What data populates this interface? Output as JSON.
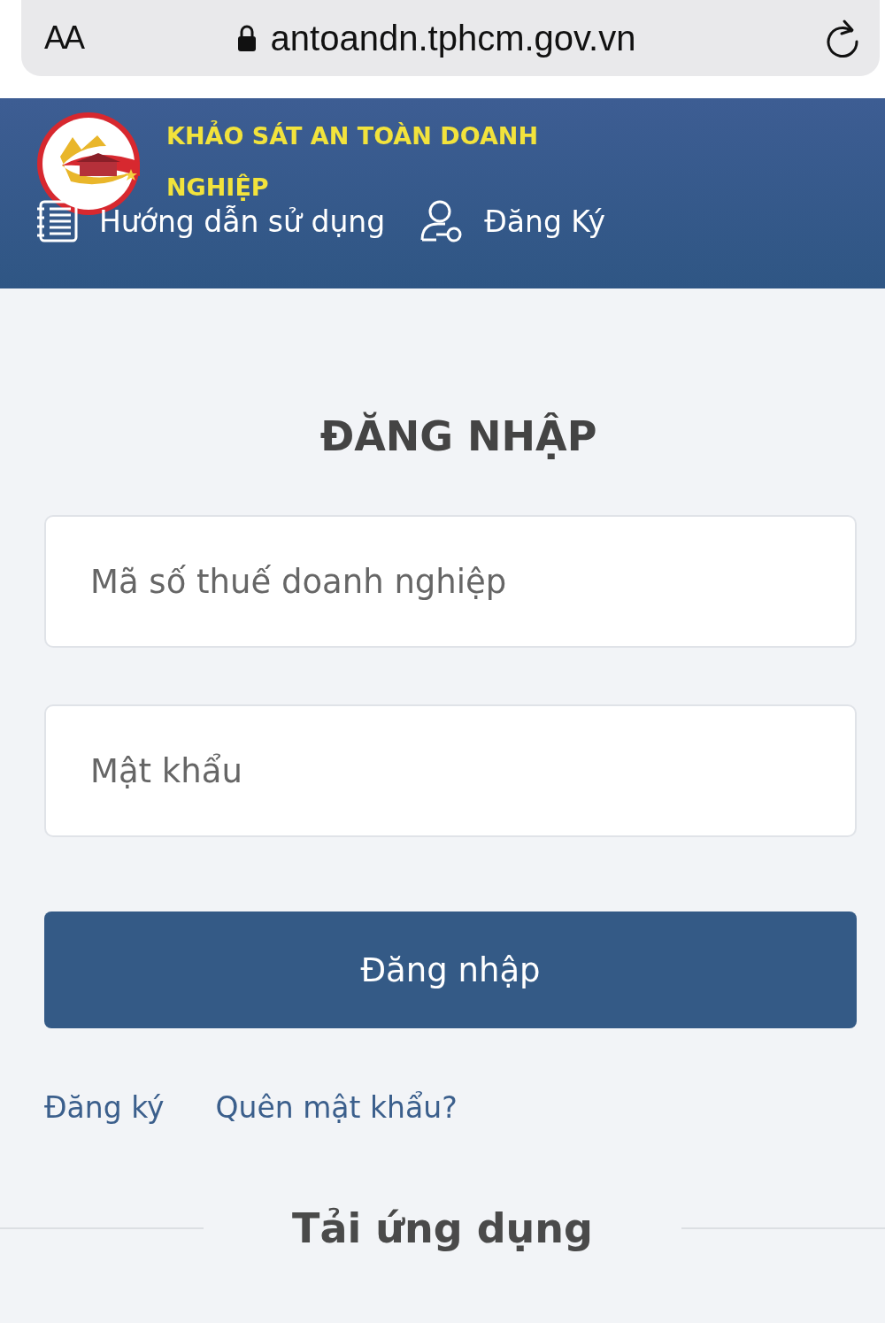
{
  "browser": {
    "text_size_button": "AA",
    "url": "antoandn.tphcm.gov.vn"
  },
  "header": {
    "title": "KHẢO SÁT AN TOÀN DOANH NGHIỆP",
    "nav": [
      {
        "kind": "guide",
        "label": "Hướng dẫn sử dụng"
      },
      {
        "kind": "register",
        "label": "Đăng Ký"
      }
    ]
  },
  "login": {
    "title": "ĐĂNG NHẬP",
    "fields": [
      {
        "placeholder": "Mã số thuế doanh nghiệp"
      },
      {
        "placeholder": "Mật khẩu"
      }
    ],
    "submit": "Đăng nhập",
    "links": [
      "Đăng ký",
      "Quên mật khẩu?"
    ]
  },
  "download": {
    "title": "Tải ứng dụng"
  }
}
